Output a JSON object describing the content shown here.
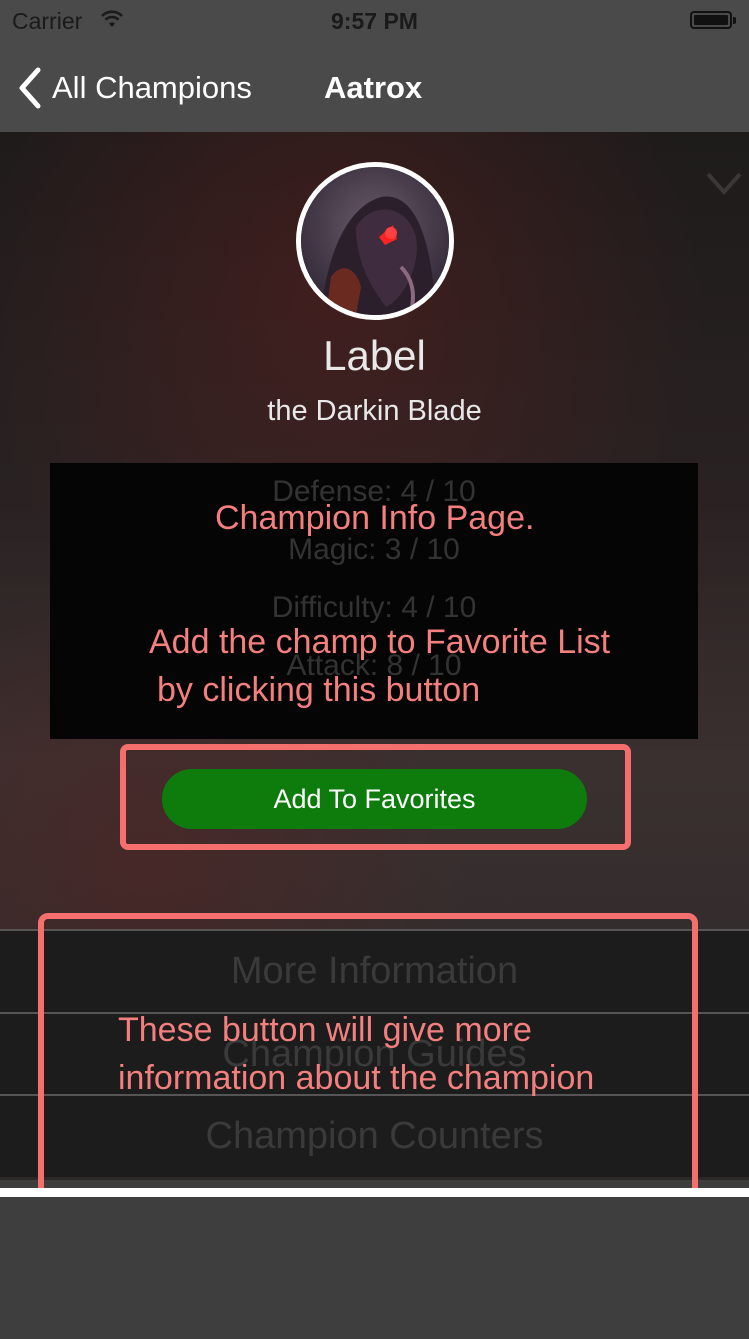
{
  "status_bar": {
    "carrier": "Carrier",
    "time": "9:57 PM"
  },
  "nav": {
    "back_label": "All Champions",
    "title": "Aatrox"
  },
  "champion": {
    "name": "Label",
    "title": "the Darkin Blade"
  },
  "stats": [
    "Defense: 4 / 10",
    "Magic: 3 / 10",
    "Difficulty: 4 / 10",
    "Attack: 8 / 10"
  ],
  "annotations": {
    "page_note": "Champion Info Page.",
    "favorite_note_line1": "Add the champ to Favorite List",
    "favorite_note_line2": "by clicking this button",
    "menu_note_line1": "These button will give more",
    "menu_note_line2": "information about the champion",
    "color": "#f47f7f"
  },
  "favorite_button": {
    "label": "Add To Favorites",
    "color": "#0d7c0d"
  },
  "menu": {
    "items": [
      "More Information",
      "Champion Guides",
      "Champion Counters"
    ]
  },
  "icons": {
    "back": "chevron-left-icon",
    "wifi": "wifi-icon",
    "battery": "battery-icon"
  }
}
